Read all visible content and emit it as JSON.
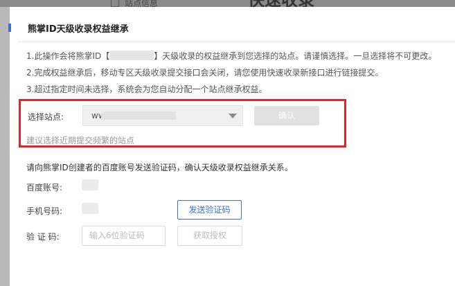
{
  "background": {
    "nav_label": "站点信息",
    "heading": "快速收录"
  },
  "modal": {
    "title": "熊掌ID天级收录权益继承",
    "notes": {
      "line1_pre": "1.此操作会将熊掌ID【",
      "line1_post": "】天级收录的权益继承到您选择的站点。请谨慎选择。一旦选择将不可更改。",
      "line2": "2.完成权益继承后，移动专区天级收录提交接口会关闭，请您使用快速收录新接口进行链接提交。",
      "line3": "3.超过指定时间未选择，系统会为您自动分配一个站点继承权益。"
    },
    "site_select": {
      "label": "选择站点:",
      "value": "ww",
      "confirm_label": "确认",
      "hint": "建议选择近期提交频繁的站点"
    },
    "verify": {
      "tip": "请向熊掌ID创建者的百度账号发送验证码，确认天级收录权益继承关系。",
      "baidu_label": "百度账号:",
      "phone_label": "手机号码:",
      "send_label": "发送验证码",
      "code_label": "验 证 码:",
      "code_placeholder": "输入6位验证码",
      "auth_label": "获取授权"
    }
  },
  "colors": {
    "accent": "#3c6fd1",
    "highlight": "#e0262b",
    "disabled": "#e1e1e1"
  }
}
